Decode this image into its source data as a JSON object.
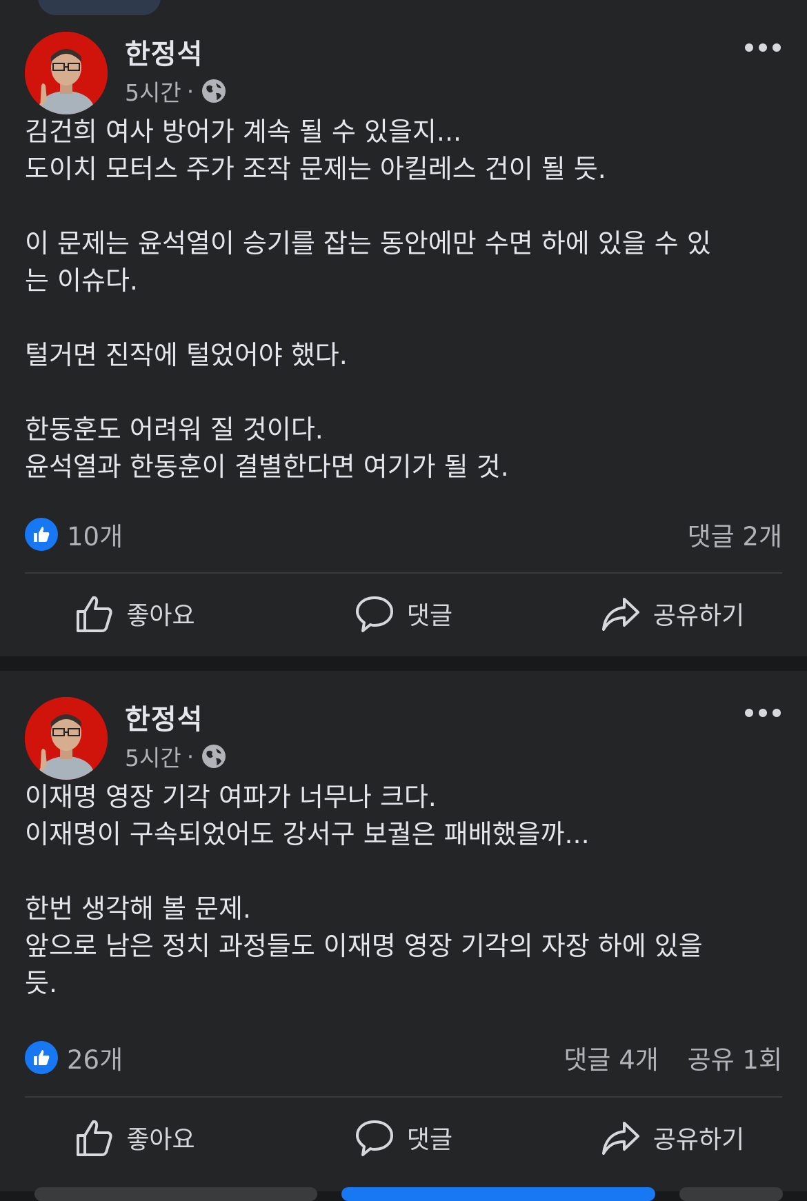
{
  "posts": [
    {
      "author": "한정석",
      "time": "5시간",
      "separator": "·",
      "body_lines": [
        "김건희 여사 방어가 계속 될 수 있을지...",
        "도이치 모터스 주가 조작 문제는 아킬레스 건이 될 듯.",
        "",
        "이 문제는 윤석열이 승기를 잡는 동안에만 수면 하에 있을 수 있",
        "는 이슈다.",
        "",
        "털거면 진작에 털었어야 했다.",
        "",
        "한동훈도 어려워 질 것이다.",
        "윤석열과 한동훈이 결별한다면 여기가 될 것."
      ],
      "likes": "10개",
      "comments": "댓글 2개",
      "shares": ""
    },
    {
      "author": "한정석",
      "time": "5시간",
      "separator": "·",
      "body_lines": [
        "이재명 영장 기각 여파가 너무나 크다.",
        "이재명이 구속되었어도 강서구 보궐은 패배했을까...",
        "",
        "한번 생각해 볼 문제.",
        "앞으로 남은 정치 과정들도 이재명 영장 기각의 자장 하에 있을",
        "듯."
      ],
      "likes": "26개",
      "comments": "댓글 4개",
      "shares": "공유 1회"
    }
  ],
  "actions": {
    "like": "좋아요",
    "comment": "댓글",
    "share": "공유하기"
  },
  "colors": {
    "background": "#18191b",
    "card": "#242526",
    "like_blue": "#1877f2",
    "avatar_red": "#d1140b"
  }
}
